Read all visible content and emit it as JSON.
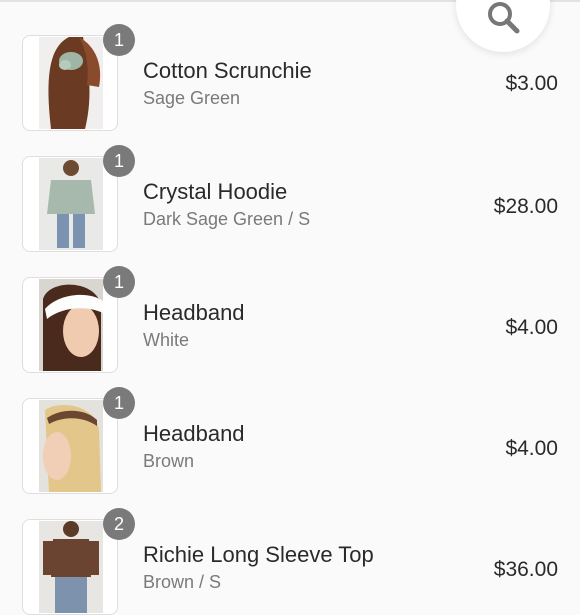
{
  "search": {
    "icon": "search-icon"
  },
  "items": [
    {
      "qty": "1",
      "name": "Cotton Scrunchie",
      "variant": "Sage Green",
      "price": "$3.00"
    },
    {
      "qty": "1",
      "name": "Crystal Hoodie",
      "variant": "Dark Sage Green / S",
      "price": "$28.00"
    },
    {
      "qty": "1",
      "name": "Headband",
      "variant": "White",
      "price": "$4.00"
    },
    {
      "qty": "1",
      "name": "Headband",
      "variant": "Brown",
      "price": "$4.00"
    },
    {
      "qty": "2",
      "name": "Richie Long Sleeve Top",
      "variant": "Brown / S",
      "price": "$36.00"
    }
  ],
  "colors": {
    "badge": "#7a7a7a",
    "background": "#fafafa",
    "price_text": "#2a2a2a"
  }
}
